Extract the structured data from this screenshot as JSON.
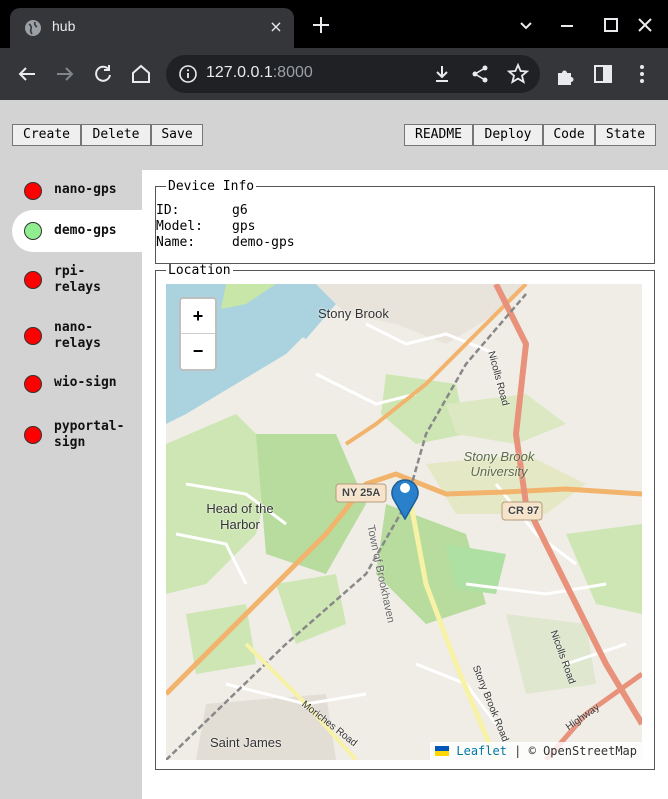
{
  "browser": {
    "tab_title": "hub",
    "tab_close": "×",
    "url_host": "127.0.0.1",
    "url_port": ":8000"
  },
  "toolbar": {
    "left_buttons": [
      "Create",
      "Delete",
      "Save"
    ],
    "right_buttons": [
      "README",
      "Deploy",
      "Code",
      "State"
    ]
  },
  "sidebar": {
    "devices": [
      {
        "label": "nano-gps",
        "status": "red"
      },
      {
        "label": "demo-gps",
        "status": "green",
        "selected": true
      },
      {
        "label": "rpi-\nrelays",
        "status": "red"
      },
      {
        "label": "nano-\nrelays",
        "status": "red"
      },
      {
        "label": "wio-sign",
        "status": "red"
      },
      {
        "label": "pyportal-\nsign",
        "status": "red"
      }
    ]
  },
  "device_info": {
    "legend": "Device Info",
    "id_label": "ID:",
    "id_value": "g6",
    "model_label": "Model:",
    "model_value": "gps",
    "name_label": "Name:",
    "name_value": "demo-gps"
  },
  "location": {
    "legend": "Location",
    "zoom_in": "+",
    "zoom_out": "−",
    "attribution_link": "Leaflet",
    "attribution_sep": " | © ",
    "attribution_osm": "OpenStreetMap",
    "labels": {
      "stony_brook": "Stony Brook",
      "university": "Stony Brook\nUniversity",
      "head_harbor": "Head of the\nHarbor",
      "ny25a": "NY 25A",
      "cr97": "CR 97",
      "nicolls_top": "Nicolls Road",
      "nicolls_bottom": "Nicolls Road",
      "brookhaven": "Town of Brookhaven",
      "stony_brook_road": "Stony Brook Road",
      "moriches": "Moriches Road",
      "saint_james": "Saint James",
      "highway": "Highway"
    }
  },
  "colors": {
    "status_red": "#ff0000",
    "status_green": "#90ee90",
    "marker": "#2a81cb"
  }
}
